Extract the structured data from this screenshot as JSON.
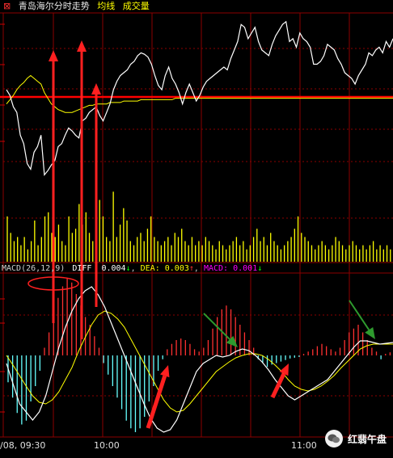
{
  "header": {
    "icon": "close-icon",
    "title": "青岛海尔分时走势",
    "avg_label": "均线",
    "vol_label": "成交量",
    "colors": {
      "title": "#e8e8e8",
      "avg": "#ffff00",
      "vol": "#ffff00",
      "icon": "#ff3030"
    }
  },
  "macd": {
    "name": "MACD(26,12,9)",
    "diff_label": "DIFF",
    "diff_value": "0.004",
    "diff_arrow": "↓",
    "dea_label": "DEA:",
    "dea_value": "0.003",
    "dea_arrow": "↑",
    "macd_label": "MACD:",
    "macd_value": "0.001",
    "macd_arrow": "↓"
  },
  "x_axis": {
    "labels": [
      "/08, 09:30",
      "10:00",
      "11:00"
    ]
  },
  "watermark": {
    "text": "红翡午盘",
    "icon": "wechat-icon"
  },
  "colors": {
    "grid": "#8b0000",
    "price_line": "#ffffff",
    "avg_line": "#ffff00",
    "ref_line": "#ff0000",
    "volume": "#ffff00",
    "hist_pos": "#ff3030",
    "hist_neg": "#66ffff",
    "annot_red": "#ff2020",
    "annot_green": "#2e9a2e"
  },
  "chart_data": [
    {
      "type": "line",
      "series": [
        {
          "values": [
            0.62,
            0.58,
            0.5,
            0.46,
            0.3,
            0.24,
            0.1,
            0.06,
            0.18,
            0.22,
            0.3,
            0.02,
            0.05,
            0.09,
            0.12,
            0.22,
            0.24,
            0.3,
            0.35,
            0.33,
            0.3,
            0.28,
            0.4,
            0.42,
            0.46,
            0.48,
            0.5,
            0.44,
            0.4,
            0.46,
            0.52,
            0.62,
            0.68,
            0.72,
            0.74,
            0.76,
            0.8,
            0.82,
            0.86,
            0.88,
            0.87,
            0.85,
            0.8,
            0.72,
            0.65,
            0.62,
            0.72,
            0.78,
            0.7,
            0.66,
            0.6,
            0.52,
            0.6,
            0.66,
            0.6,
            0.54,
            0.58,
            0.64,
            0.68,
            0.7,
            0.72,
            0.74,
            0.76,
            0.78,
            0.76,
            0.84,
            0.9,
            0.96,
            1.08,
            1.06,
            0.98,
            1.02,
            1.06,
            0.96,
            0.9,
            0.88,
            0.86,
            0.94,
            1.0,
            1.04,
            1.08,
            1.1,
            0.96,
            0.98,
            0.92,
            1.02,
            0.98,
            0.96,
            0.92,
            0.8,
            0.8,
            0.82,
            0.86,
            0.94,
            0.92,
            0.9,
            0.84,
            0.8,
            0.74,
            0.72,
            0.7,
            0.66,
            0.72,
            0.76,
            0.8,
            0.88,
            0.86,
            0.9,
            0.92,
            0.88,
            0.96,
            0.92,
            0.98
          ]
        },
        {
          "values": [
            0.52,
            0.55,
            0.58,
            0.62,
            0.65,
            0.67,
            0.7,
            0.72,
            0.7,
            0.68,
            0.66,
            0.6,
            0.56,
            0.52,
            0.5,
            0.48,
            0.47,
            0.46,
            0.46,
            0.46,
            0.47,
            0.48,
            0.49,
            0.5,
            0.51,
            0.51,
            0.52,
            0.52,
            0.52,
            0.52,
            0.53,
            0.53,
            0.53,
            0.53,
            0.54,
            0.54,
            0.54,
            0.54,
            0.54,
            0.55,
            0.55,
            0.55,
            0.55,
            0.55,
            0.55,
            0.55,
            0.55,
            0.55,
            0.55,
            0.56,
            0.56,
            0.56,
            0.56,
            0.56,
            0.56,
            0.56,
            0.56,
            0.56,
            0.56,
            0.56,
            0.56,
            0.56,
            0.56,
            0.56,
            0.56,
            0.56,
            0.56,
            0.56,
            0.56,
            0.56,
            0.56,
            0.56,
            0.56,
            0.56,
            0.56,
            0.56,
            0.56,
            0.56,
            0.56,
            0.56,
            0.56,
            0.56,
            0.56,
            0.56,
            0.56,
            0.56,
            0.56,
            0.56,
            0.56,
            0.56,
            0.56,
            0.56,
            0.56,
            0.56,
            0.56,
            0.56,
            0.56,
            0.56,
            0.56,
            0.56,
            0.56,
            0.56,
            0.56,
            0.56,
            0.56,
            0.56,
            0.56,
            0.56,
            0.56,
            0.56,
            0.56,
            0.56,
            0.56
          ]
        }
      ]
    },
    {
      "type": "bar",
      "values": [
        0.55,
        0.35,
        0.25,
        0.3,
        0.2,
        0.3,
        0.15,
        0.25,
        0.5,
        0.2,
        0.3,
        0.55,
        0.6,
        0.35,
        0.3,
        0.45,
        0.25,
        0.2,
        0.55,
        0.35,
        0.4,
        0.7,
        0.45,
        0.6,
        0.35,
        0.25,
        0.2,
        0.75,
        0.55,
        0.3,
        0.25,
        0.85,
        0.3,
        0.45,
        0.65,
        0.5,
        0.25,
        0.2,
        0.3,
        0.35,
        0.25,
        0.4,
        0.55,
        0.3,
        0.25,
        0.2,
        0.25,
        0.3,
        0.2,
        0.35,
        0.3,
        0.4,
        0.25,
        0.2,
        0.3,
        0.2,
        0.25,
        0.2,
        0.3,
        0.25,
        0.2,
        0.15,
        0.25,
        0.2,
        0.15,
        0.2,
        0.25,
        0.3,
        0.2,
        0.25,
        0.15,
        0.2,
        0.3,
        0.4,
        0.25,
        0.3,
        0.2,
        0.35,
        0.25,
        0.2,
        0.15,
        0.2,
        0.25,
        0.3,
        0.4,
        0.55,
        0.35,
        0.3,
        0.25,
        0.2,
        0.15,
        0.2,
        0.25,
        0.2,
        0.15,
        0.2,
        0.3,
        0.25,
        0.2,
        0.15,
        0.2,
        0.25,
        0.2,
        0.15,
        0.2,
        0.15,
        0.2,
        0.25,
        0.15,
        0.2,
        0.15,
        0.2,
        0.15
      ]
    },
    {
      "type": "bar",
      "values": [
        -0.35,
        -0.55,
        -0.75,
        -0.9,
        -0.85,
        -0.6,
        -0.4,
        -0.2,
        0.1,
        0.3,
        0.55,
        0.75,
        0.9,
        1.0,
        0.95,
        0.8,
        0.65,
        0.5,
        0.4,
        0.25,
        0.1,
        -0.1,
        -0.25,
        -0.4,
        -0.55,
        -0.7,
        -0.85,
        -0.95,
        -1.0,
        -0.95,
        -0.8,
        -0.6,
        -0.4,
        -0.2,
        -0.05,
        0.08,
        0.15,
        0.2,
        0.22,
        0.2,
        0.15,
        0.08,
        0.05,
        0.1,
        0.2,
        0.35,
        0.5,
        0.6,
        0.65,
        0.6,
        0.5,
        0.4,
        0.3,
        0.2,
        0.1,
        -0.05,
        -0.1,
        -0.15,
        -0.12,
        -0.1,
        -0.08,
        -0.06,
        -0.04,
        -0.03,
        -0.02,
        0.02,
        0.05,
        0.08,
        0.12,
        0.15,
        0.12,
        0.08,
        0.05,
        0.1,
        0.2,
        0.3,
        0.35,
        0.4,
        0.3,
        0.2,
        0.1,
        0.05,
        -0.05,
        0.02,
        0.04
      ],
      "series": [
        {
          "values": [
            -0.1,
            -0.35,
            -0.6,
            -0.7,
            -0.8,
            -0.7,
            -0.5,
            -0.2,
            0.1,
            0.35,
            0.55,
            0.7,
            0.8,
            0.85,
            0.75,
            0.6,
            0.4,
            0.2,
            0.0,
            -0.2,
            -0.4,
            -0.6,
            -0.78,
            -0.9,
            -0.95,
            -0.92,
            -0.8,
            -0.6,
            -0.4,
            -0.2,
            -0.1,
            -0.05,
            0.0,
            -0.02,
            0.0,
            0.05,
            0.08,
            0.06,
            0.0,
            -0.08,
            -0.18,
            -0.3,
            -0.4,
            -0.5,
            -0.55,
            -0.5,
            -0.45,
            -0.4,
            -0.35,
            -0.3,
            -0.2,
            -0.1,
            0.0,
            0.1,
            0.18,
            0.18,
            0.16,
            0.14,
            0.15,
            0.16
          ]
        },
        {
          "values": [
            0.0,
            -0.12,
            -0.25,
            -0.38,
            -0.5,
            -0.58,
            -0.6,
            -0.55,
            -0.45,
            -0.3,
            -0.15,
            0.05,
            0.22,
            0.38,
            0.5,
            0.55,
            0.52,
            0.45,
            0.35,
            0.2,
            0.05,
            -0.1,
            -0.25,
            -0.4,
            -0.55,
            -0.65,
            -0.7,
            -0.68,
            -0.6,
            -0.5,
            -0.4,
            -0.3,
            -0.2,
            -0.14,
            -0.08,
            -0.03,
            0.0,
            0.02,
            0.02,
            0.0,
            -0.05,
            -0.12,
            -0.2,
            -0.3,
            -0.38,
            -0.42,
            -0.44,
            -0.42,
            -0.38,
            -0.32,
            -0.25,
            -0.16,
            -0.08,
            0.0,
            0.08,
            0.12,
            0.14,
            0.14,
            0.14,
            0.14
          ]
        }
      ]
    }
  ]
}
